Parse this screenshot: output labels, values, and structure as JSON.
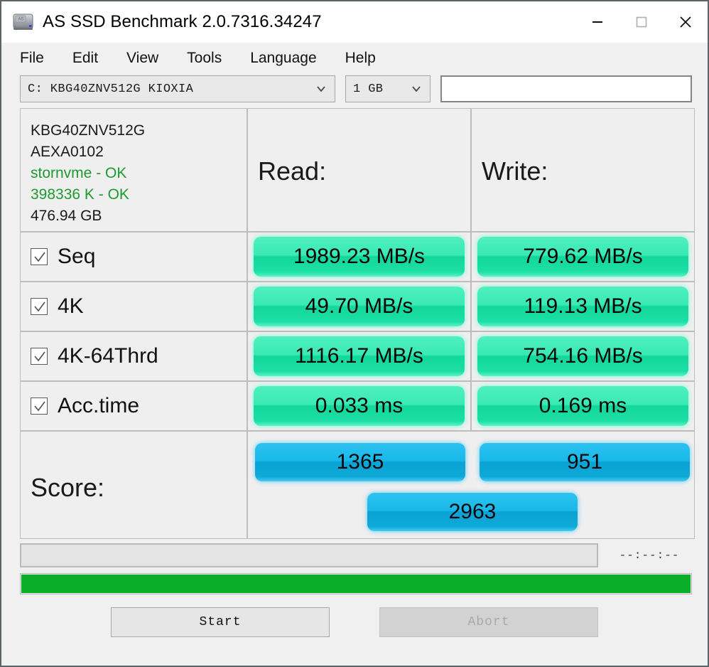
{
  "window": {
    "title": "AS SSD Benchmark 2.0.7316.34247",
    "icon": "ssd-drive-icon",
    "controls": {
      "minimize": "minimize-icon",
      "maximize": "maximize-icon",
      "close": "close-icon"
    }
  },
  "menu": {
    "items": [
      {
        "label": "File"
      },
      {
        "label": "Edit"
      },
      {
        "label": "View"
      },
      {
        "label": "Tools"
      },
      {
        "label": "Language"
      },
      {
        "label": "Help"
      }
    ]
  },
  "toolbar": {
    "drive_select": "C: KBG40ZNV512G KIOXIA",
    "size_select": "1 GB",
    "status_field_value": "",
    "status_field_placeholder": ""
  },
  "drive_info": {
    "model": "KBG40ZNV512G",
    "firmware": "AEXA0102",
    "driver": "stornvme - OK",
    "alignment": "398336 K - OK",
    "capacity": "476.94 GB",
    "ok_color": "#1e9b2e"
  },
  "headers": {
    "read": "Read:",
    "write": "Write:",
    "score": "Score:"
  },
  "tests": [
    {
      "name": "Seq",
      "checked": true,
      "read": "1989.23 MB/s",
      "write": "779.62 MB/s"
    },
    {
      "name": "4K",
      "checked": true,
      "read": "49.70 MB/s",
      "write": "119.13 MB/s"
    },
    {
      "name": "4K-64Thrd",
      "checked": true,
      "read": "1116.17 MB/s",
      "write": "754.16 MB/s"
    },
    {
      "name": "Acc.time",
      "checked": true,
      "read": "0.033 ms",
      "write": "0.169 ms"
    }
  ],
  "scores": {
    "read": "1365",
    "write": "951",
    "total": "2963"
  },
  "status": {
    "message": "",
    "elapsed": "--:--:--",
    "progress_percent": 100,
    "progress_color": "#0bae29"
  },
  "buttons": {
    "start": "Start",
    "abort": "Abort"
  },
  "colors": {
    "result_green": "#2fe4ad",
    "score_blue": "#12b3e4",
    "window_bg": "#f0f0f0"
  }
}
